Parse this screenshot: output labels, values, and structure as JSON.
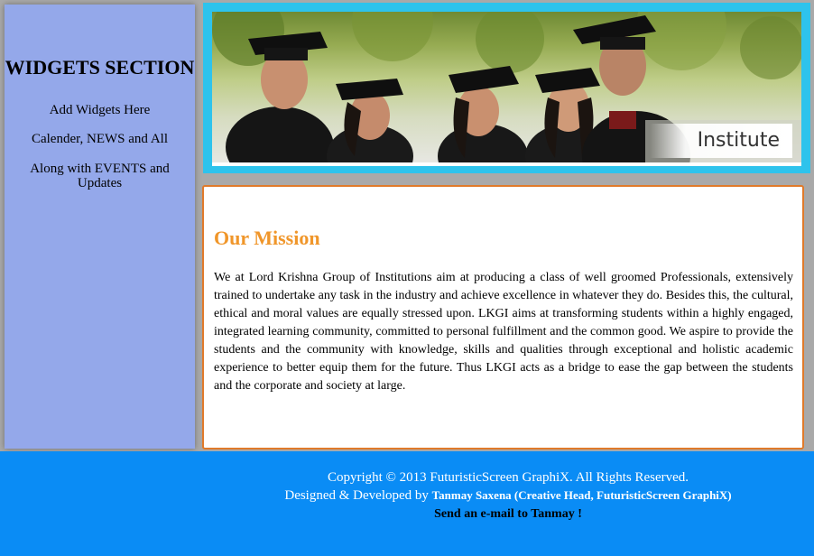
{
  "sidebar": {
    "title": "WIDGETS SECTION",
    "lines": [
      "Add Widgets Here",
      "Calender, NEWS and All",
      "Along with EVENTS and Updates"
    ]
  },
  "banner": {
    "label": "Institute",
    "photo": "graduates-in-caps-photo"
  },
  "main": {
    "heading": "Our Mission",
    "body": "We at Lord Krishna Group of Institutions aim at producing a class of well groomed Professionals, extensively trained to undertake any task in the industry and achieve excellence in whatever they do. Besides this, the cultural, ethical and moral values are equally stressed upon. LKGI aims at transforming students within a highly engaged, integrated learning community, committed to personal fulfillment and the common good. We aspire to provide the students and the community with knowledge, skills and qualities through exceptional and holistic academic experience to better equip them for the future. Thus LKGI acts as a bridge to ease the gap between the students and the corporate and society at large."
  },
  "footer": {
    "copyright": "Copyright © 2013 FuturisticScreen GraphiX. All Rights Reserved.",
    "designed_prefix": "Designed & Developed by",
    "designed_name": "Tanmay Saxena (Creative Head, FuturisticScreen GraphiX)",
    "email_link": "Send an e-mail to Tanmay !"
  },
  "colors": {
    "sidebar_bg": "#94a8ea",
    "banner_frame": "#2ec3ec",
    "content_border": "#e07a2a",
    "heading": "#f0962a",
    "footer_bg": "#0a8cf5"
  }
}
